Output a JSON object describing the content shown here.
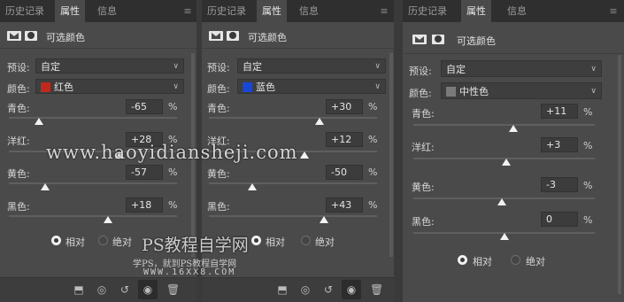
{
  "panels": [
    {
      "tabs": [
        "历史记录",
        "属性",
        "信息"
      ],
      "active_tab": 1,
      "header_title": "可选颜色",
      "preset_label": "预设:",
      "preset_value": "自定",
      "color_label": "颜色:",
      "color_value": "红色",
      "color_swatch": "#c0281c",
      "sliders": [
        {
          "label": "青色:",
          "value": "-65",
          "unit": "%"
        },
        {
          "label": "洋红:",
          "value": "+28",
          "unit": "%"
        },
        {
          "label": "黄色:",
          "value": "-57",
          "unit": "%"
        },
        {
          "label": "黑色:",
          "value": "+18",
          "unit": "%"
        }
      ],
      "radio_relative": "相对",
      "radio_absolute": "绝对"
    },
    {
      "tabs": [
        "历史记录",
        "属性",
        "信息"
      ],
      "active_tab": 1,
      "header_title": "可选颜色",
      "preset_label": "预设:",
      "preset_value": "自定",
      "color_label": "颜色:",
      "color_value": "蓝色",
      "color_swatch": "#1847d8",
      "sliders": [
        {
          "label": "青色:",
          "value": "+30",
          "unit": "%"
        },
        {
          "label": "洋红:",
          "value": "+12",
          "unit": "%"
        },
        {
          "label": "黄色:",
          "value": "-50",
          "unit": "%"
        },
        {
          "label": "黑色:",
          "value": "+43",
          "unit": "%"
        }
      ],
      "radio_relative": "相对",
      "radio_absolute": "绝对"
    },
    {
      "tabs": [
        "历史记录",
        "属性",
        "信息"
      ],
      "active_tab": 1,
      "header_title": "可选颜色",
      "preset_label": "预设:",
      "preset_value": "自定",
      "color_label": "颜色:",
      "color_value": "中性色",
      "color_swatch": "#7a7a7a",
      "sliders": [
        {
          "label": "青色:",
          "value": "+11",
          "unit": "%"
        },
        {
          "label": "洋红:",
          "value": "+3",
          "unit": "%"
        },
        {
          "label": "黄色:",
          "value": "-3",
          "unit": "%"
        },
        {
          "label": "黑色:",
          "value": "0",
          "unit": "%"
        }
      ],
      "radio_relative": "相对",
      "radio_absolute": "绝对"
    }
  ],
  "watermark": {
    "site": "www.haoyidiansheji.com",
    "title": "PS教程自学网",
    "subtitle": "学PS，就到PS教程自学网",
    "url": "WWW.16XX8.COM"
  },
  "icons": {
    "panel_menu": "panel-menu-icon",
    "layer_mask": "layer-mask-icon",
    "adjustment": "adjustment-layer-icon",
    "clip": "clip-to-layer-icon",
    "view_previous": "view-previous-state-icon",
    "reset": "reset-icon",
    "visibility": "eye-icon",
    "delete": "trash-icon"
  }
}
